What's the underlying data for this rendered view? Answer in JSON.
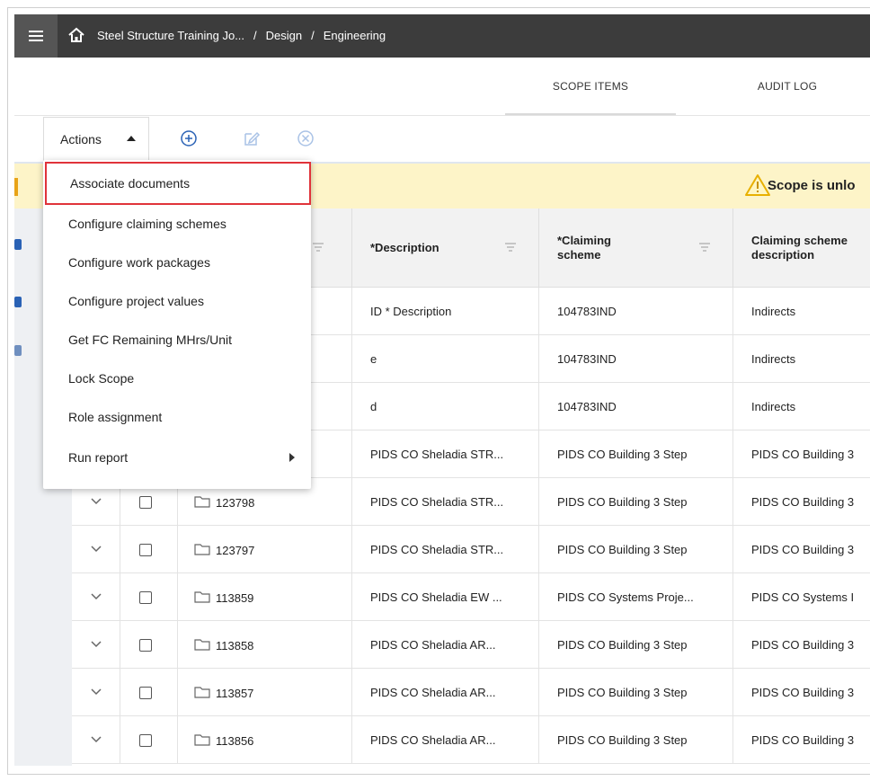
{
  "breadcrumb": [
    "Steel Structure Training Jo...",
    "Design",
    "Engineering"
  ],
  "breadcrumb_separator": "/",
  "tabs": [
    {
      "label": "SCOPE ITEMS",
      "active": true
    },
    {
      "label": "AUDIT LOG",
      "active": false
    }
  ],
  "toolbar": {
    "actions_label": "Actions"
  },
  "banner": {
    "text": "Scope is unlo"
  },
  "columns": [
    {
      "label": "*Description"
    },
    {
      "label": "*Claiming scheme"
    },
    {
      "label": "Claiming scheme description"
    }
  ],
  "actions_menu": [
    {
      "label": "Associate documents",
      "highlighted": true
    },
    {
      "label": "Configure claiming schemes"
    },
    {
      "label": "Configure work packages"
    },
    {
      "label": "Configure project values"
    },
    {
      "label": "Get FC Remaining MHrs/Unit"
    },
    {
      "label": "Lock Scope"
    },
    {
      "label": "Role assignment"
    },
    {
      "label": "Run report",
      "has_submenu": true
    }
  ],
  "rows": [
    {
      "id": "",
      "description": "ID * Description",
      "scheme": "104783IND",
      "scheme_desc": "Indirects"
    },
    {
      "id": "",
      "description": "e",
      "scheme": "104783IND",
      "scheme_desc": "Indirects"
    },
    {
      "id": "",
      "description": "d",
      "scheme": "104783IND",
      "scheme_desc": "Indirects"
    },
    {
      "id": "",
      "description": "PIDS CO Sheladia STR...",
      "scheme": "PIDS CO Building 3 Step",
      "scheme_desc": "PIDS CO Building 3"
    },
    {
      "id": "123798",
      "description": "PIDS CO Sheladia STR...",
      "scheme": "PIDS CO Building 3 Step",
      "scheme_desc": "PIDS CO Building 3"
    },
    {
      "id": "123797",
      "description": "PIDS CO Sheladia STR...",
      "scheme": "PIDS CO Building 3 Step",
      "scheme_desc": "PIDS CO Building 3"
    },
    {
      "id": "113859",
      "description": "PIDS CO Sheladia EW ...",
      "scheme": "PIDS CO Systems Proje...",
      "scheme_desc": "PIDS CO Systems I"
    },
    {
      "id": "113858",
      "description": "PIDS CO Sheladia AR...",
      "scheme": "PIDS CO Building 3 Step",
      "scheme_desc": "PIDS CO Building 3"
    },
    {
      "id": "113857",
      "description": "PIDS CO Sheladia AR...",
      "scheme": "PIDS CO Building 3 Step",
      "scheme_desc": "PIDS CO Building 3"
    },
    {
      "id": "113856",
      "description": "PIDS CO Sheladia AR...",
      "scheme": "PIDS CO Building 3 Step",
      "scheme_desc": "PIDS CO Building 3"
    }
  ],
  "colors": {
    "topbar": "#3c3c3c",
    "banner": "#fdf4c8",
    "highlight_border": "#e0333a",
    "accent_blue": "#2a62b5"
  }
}
